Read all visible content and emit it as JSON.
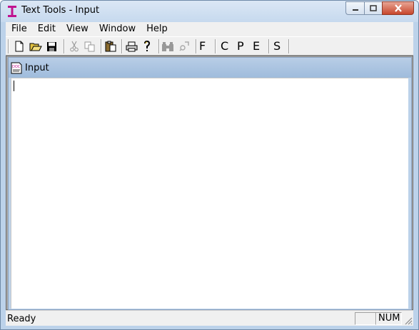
{
  "window": {
    "title": "Text Tools - Input"
  },
  "menu": {
    "items": [
      "File",
      "Edit",
      "View",
      "Window",
      "Help"
    ]
  },
  "toolbar": {
    "buttons": [
      "new-file",
      "open-folder",
      "save",
      "cut",
      "copy",
      "paste",
      "print",
      "help",
      "find",
      "find-replace"
    ],
    "letters": [
      "F",
      "C",
      "P",
      "E",
      "S"
    ]
  },
  "child_window": {
    "title": "Input",
    "icon": "doc-icon"
  },
  "editor": {
    "text": ""
  },
  "status": {
    "text": "Ready",
    "pane1": "",
    "pane2": "NUM"
  },
  "colors": {
    "frame": "#bcd2ea",
    "close": "#c7462c",
    "accent_title": "#9fbcdc"
  }
}
